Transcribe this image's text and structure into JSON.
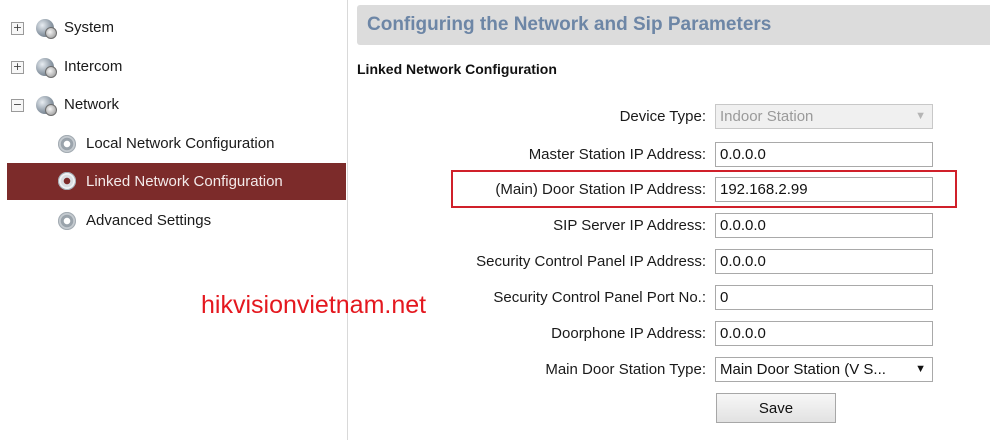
{
  "sidebar": {
    "items": [
      {
        "label": "System",
        "expander": "+",
        "icon": "globe-icon"
      },
      {
        "label": "Intercom",
        "expander": "+",
        "icon": "globe-icon"
      },
      {
        "label": "Network",
        "expander": "−",
        "icon": "globe-icon"
      },
      {
        "label": "Local Network Configuration",
        "icon": "gear-icon"
      },
      {
        "label": "Linked Network Configuration",
        "icon": "gear-icon",
        "selected": true
      },
      {
        "label": "Advanced Settings",
        "icon": "gear-icon"
      }
    ]
  },
  "header": {
    "title": "Configuring the Network and Sip Parameters"
  },
  "section": {
    "title": "Linked Network Configuration"
  },
  "form": {
    "device_type": {
      "label": "Device Type:",
      "value": "Indoor Station",
      "disabled": true
    },
    "master_station_ip": {
      "label": "Master Station IP Address:",
      "value": "0.0.0.0"
    },
    "door_station_ip": {
      "label": "(Main) Door Station IP Address:",
      "value": "192.168.2.99"
    },
    "sip_server_ip": {
      "label": "SIP Server IP Address:",
      "value": "0.0.0.0"
    },
    "security_panel_ip": {
      "label": "Security Control Panel IP Address:",
      "value": "0.0.0.0"
    },
    "security_panel_port": {
      "label": "Security Control Panel Port No.:",
      "value": "0"
    },
    "doorphone_ip": {
      "label": "Doorphone IP Address:",
      "value": "0.0.0.0"
    },
    "main_door_station_type": {
      "label": "Main Door Station Type:",
      "value": "Main Door Station (V S..."
    },
    "save_label": "Save"
  },
  "watermark": "hikvisionvietnam.net",
  "colors": {
    "selected_bg": "#7c2b2a",
    "banner_title": "#6d86a6",
    "highlight": "#d0202a",
    "watermark": "#e4181f"
  }
}
